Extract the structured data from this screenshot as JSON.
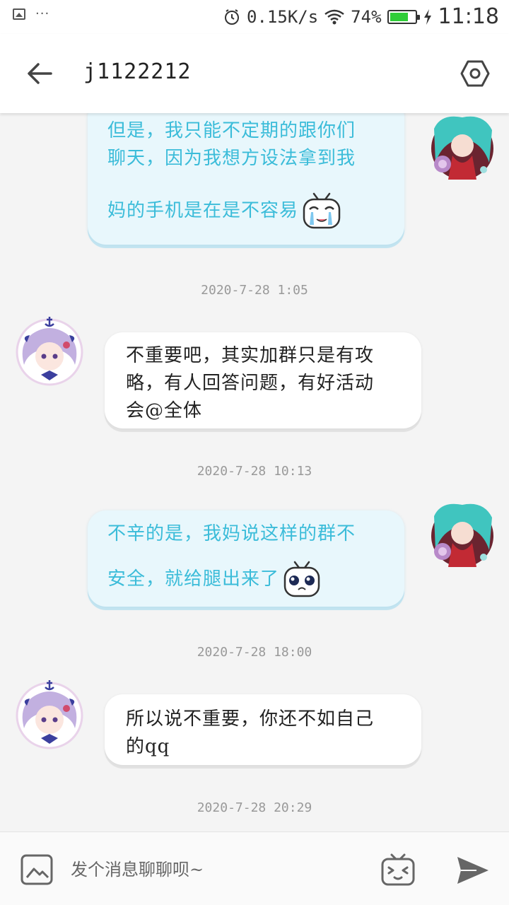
{
  "status_bar": {
    "network_speed": "0.15K/s",
    "battery_percent": "74%",
    "battery_level": 0.74,
    "time": "11:18"
  },
  "header": {
    "title": "j1122212",
    "back_icon": "arrow-left-icon",
    "settings_icon": "hexagon-settings-icon"
  },
  "messages": [
    {
      "side": "right",
      "lines": [
        "但是，我只能不定期的跟你们",
        "聊天，因为我想方设法拿到我",
        "妈的手机是在是不容易"
      ],
      "sticker": "crying-tv-sticker"
    },
    {
      "timestamp": "2020-7-28 1:05"
    },
    {
      "side": "left",
      "lines": [
        "不重要吧，其实加群只是有攻",
        "略，有人回答问题，有好活动",
        "会@全体"
      ]
    },
    {
      "timestamp": "2020-7-28 10:13"
    },
    {
      "side": "right",
      "lines": [
        "不辛的是，我妈说这样的群不",
        "安全，就给腿出来了"
      ],
      "sticker": "teary-tv-sticker"
    },
    {
      "timestamp": "2020-7-28 18:00"
    },
    {
      "side": "left",
      "lines": [
        "所以说不重要，你还不如自己",
        "的qq"
      ]
    },
    {
      "timestamp": "2020-7-28 20:29"
    }
  ],
  "input_bar": {
    "placeholder": "发个消息聊聊呗~",
    "image_icon": "image-picker-icon",
    "emoji_icon": "tv-emoji-icon",
    "send_icon": "send-icon"
  },
  "colors": {
    "self_bubble_bg": "#e8f7fc",
    "self_bubble_text": "#3bbcd9",
    "other_bubble_bg": "#ffffff",
    "timestamp_text": "#999999"
  }
}
